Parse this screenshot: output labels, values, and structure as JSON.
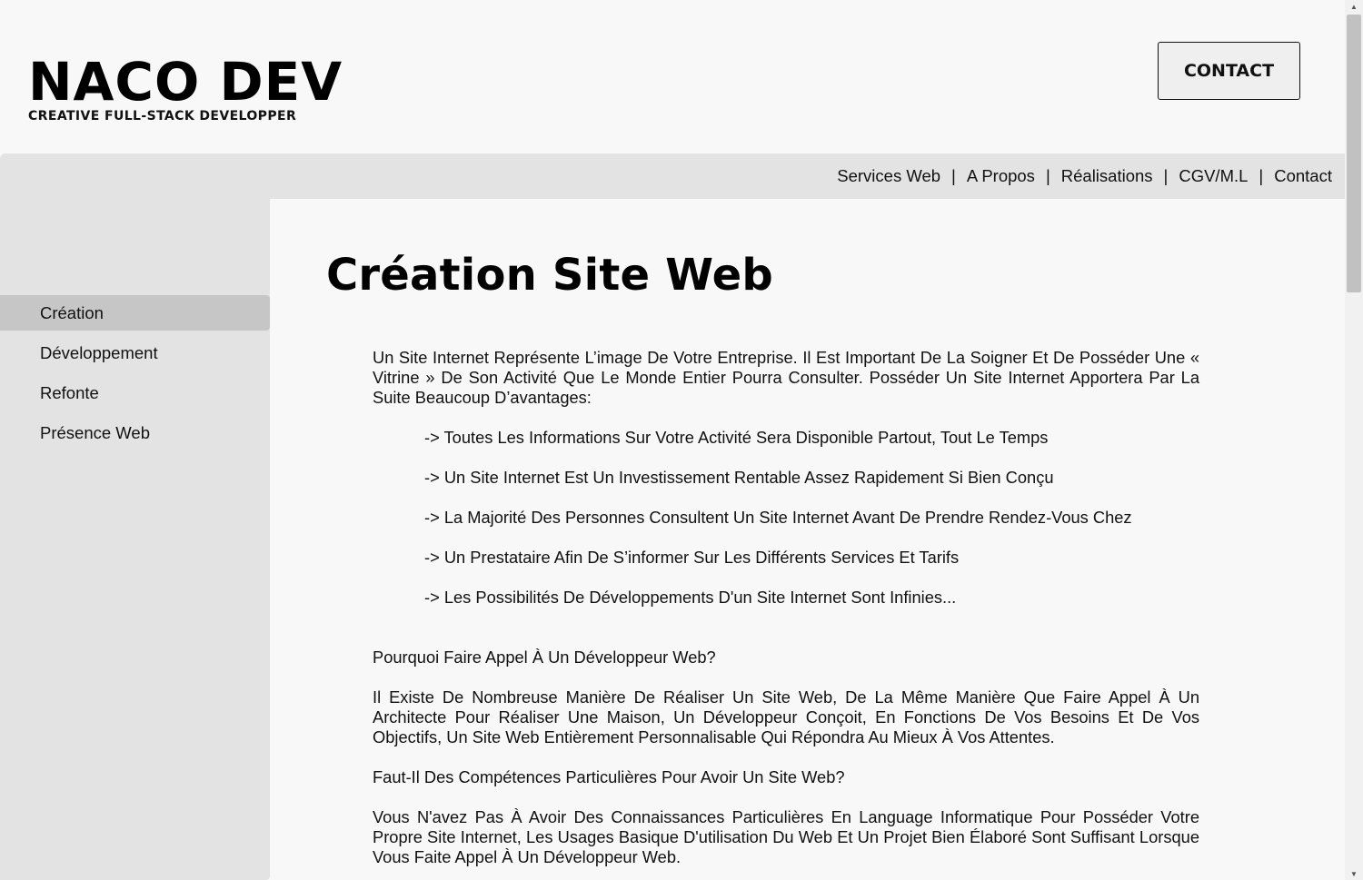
{
  "header": {
    "brand_title": "NACO DEV",
    "brand_subtitle": "CREATIVE FULL-STACK DEVELOPPER",
    "contact_button": "CONTACT"
  },
  "nav": {
    "items": [
      "Services Web",
      "A Propos",
      "Réalisations",
      "CGV/M.L",
      "Contact"
    ],
    "separator": "|"
  },
  "sidebar": {
    "items": [
      {
        "label": "Création",
        "active": true
      },
      {
        "label": "Développement",
        "active": false
      },
      {
        "label": "Refonte",
        "active": false
      },
      {
        "label": "Présence Web",
        "active": false
      }
    ]
  },
  "main": {
    "title": "Création Site Web",
    "intro": "Un Site Internet Représente L’image De Votre Entreprise. Il Est Important De La Soigner Et De Posséder Une « Vitrine » De Son Activité Que Le Monde Entier Pourra Consulter. Posséder Un Site Internet Apportera Par La Suite Beaucoup D’avantages:",
    "bullets": [
      "-> Toutes Les Informations Sur Votre Activité Sera Disponible Partout, Tout Le Temps",
      "-> Un Site Internet Est Un Investissement Rentable Assez Rapidement Si Bien Conçu",
      "-> La Majorité Des Personnes Consultent Un Site Internet Avant De Prendre Rendez-Vous Chez",
      "-> Un Prestataire Afin De S’informer Sur Les Différents Services Et Tarifs",
      "-> Les Possibilités De Développements D'un Site Internet Sont Infinies..."
    ],
    "question1": "Pourquoi Faire Appel À Un Développeur Web?",
    "answer1": "Il Existe De Nombreuse Manière De Réaliser Un Site Web, De La Même Manière Que Faire Appel À Un Architecte Pour Réaliser Une Maison, Un Développeur Conçoit, En Fonctions De Vos Besoins Et De Vos Objectifs, Un Site Web Entièrement Personnalisable Qui Répondra Au Mieux À Vos Attentes.",
    "question2": "Faut-Il Des Compétences Particulières Pour Avoir Un Site Web?",
    "answer2": "Vous N'avez Pas À Avoir Des Connaissances Particulières En Language Informatique Pour Posséder Votre Propre Site Internet, Les Usages Basique D'utilisation Du Web Et Un Projet Bien Élaboré Sont Suffisant Lorsque Vous Faite Appel À Un Développeur Web."
  },
  "scrollbar": {
    "up_icon": "triangle-up",
    "down_icon": "triangle-down"
  }
}
